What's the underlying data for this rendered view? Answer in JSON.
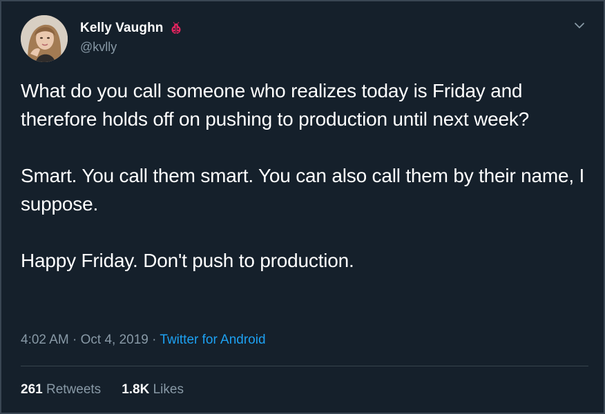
{
  "author": {
    "display_name": "Kelly Vaughn",
    "handle": "@kvlly",
    "badge_icon": "ladybug-icon",
    "badge_color": "#e0245e"
  },
  "tweet": {
    "paragraphs": [
      "What do you call someone who realizes today is Friday and therefore holds off on pushing to production until next week?",
      "Smart. You call them smart. You can also call them by their name, I suppose.",
      "Happy Friday. Don't push to production."
    ],
    "time": "4:02 AM",
    "date": "Oct 4, 2019",
    "separator": "·",
    "source": "Twitter for Android"
  },
  "stats": {
    "retweets_count": "261",
    "retweets_label": "Retweets",
    "likes_count": "1.8K",
    "likes_label": "Likes"
  },
  "colors": {
    "background": "#15202b",
    "secondary_text": "#8899a6",
    "link": "#1da1f2"
  }
}
